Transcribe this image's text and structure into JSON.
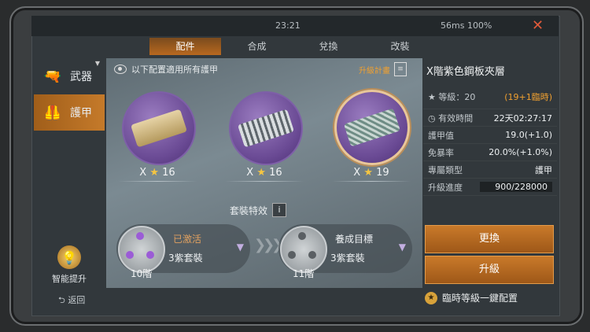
{
  "status_bar": {
    "time": "23:21",
    "network": "56ms 100%",
    "close_icon": "close-icon"
  },
  "tabs": [
    {
      "label": "配件",
      "active": true
    },
    {
      "label": "合成",
      "active": false
    },
    {
      "label": "兌換",
      "active": false
    },
    {
      "label": "改裝",
      "active": false
    }
  ],
  "left_nav": [
    {
      "label": "武器",
      "icon": "pistol-icon",
      "active": false
    },
    {
      "label": "護甲",
      "icon": "vest-icon",
      "active": true
    }
  ],
  "smart_upgrade": {
    "label": "智能提升",
    "icon": "lightbulb-icon"
  },
  "back": {
    "label": "返回",
    "icon": "back-arrow-icon"
  },
  "notice": {
    "text": "以下配置適用所有護甲",
    "icon": "eye-icon"
  },
  "upgrade_plan": {
    "label": "升級計畫",
    "icon": "document-icon"
  },
  "materials": [
    {
      "grade": "X",
      "stars": "16",
      "type": "gold",
      "selected": false
    },
    {
      "grade": "X",
      "stars": "16",
      "type": "steel",
      "selected": false
    },
    {
      "grade": "X",
      "stars": "19",
      "type": "mesh",
      "selected": true
    }
  ],
  "set_effect": {
    "title": "套裝特效",
    "items": [
      {
        "status": "已激活",
        "count": "3紫套裝",
        "level": "10階",
        "status_color": "#e0a060"
      },
      {
        "status": "養成目標",
        "count": "3紫套裝",
        "level": "11階",
        "status_color": "#eef1f3"
      }
    ]
  },
  "detail": {
    "title": "X階紫色鋼板夾層",
    "level_label": "等級：20",
    "level_bonus": "(19+1臨時)",
    "time_label": "有效時間",
    "time_value": "22天02:27:17",
    "stats": [
      {
        "label": "護甲值",
        "value": "19.0(+1.0)"
      },
      {
        "label": "免暴率",
        "value": "20.0%(+1.0%)"
      },
      {
        "label": "專屬類型",
        "value": "護甲"
      }
    ],
    "progress_label": "升級進度",
    "progress_value": "900/228000"
  },
  "buttons": {
    "replace": "更換",
    "upgrade": "升級"
  },
  "quick_config": {
    "label": "臨時等級一鍵配置",
    "icon": "star-coin-icon"
  }
}
